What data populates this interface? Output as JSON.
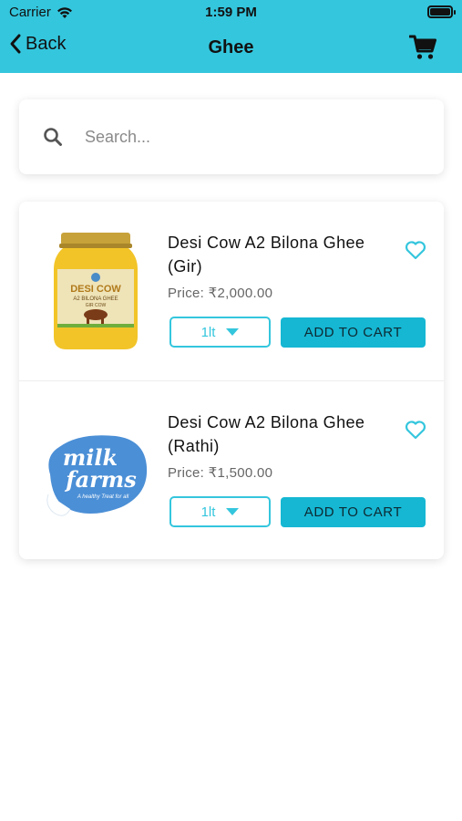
{
  "status_bar": {
    "carrier": "Carrier",
    "time": "1:59 PM"
  },
  "nav": {
    "back_label": "Back",
    "title": "Ghee"
  },
  "search": {
    "placeholder": "Search..."
  },
  "products": [
    {
      "name": "Desi Cow A2 Bilona Ghee (Gir)",
      "price": "Price: ₹2,000.00",
      "quantity": "1lt",
      "add_label": "ADD TO CART",
      "image_text": {
        "line1": "DESI COW",
        "line2": "A2 BILONA GHEE",
        "line3": "GIR COW"
      }
    },
    {
      "name": "Desi Cow A2 Bilona Ghee (Rathi)",
      "price": "Price: ₹1,500.00",
      "quantity": "1lt",
      "add_label": "ADD TO CART",
      "image_text": {
        "line1": "milk",
        "line2": "farms",
        "line3": "A healthy Treat for all"
      }
    }
  ],
  "colors": {
    "accent": "#34c6dd",
    "button": "#15b7d3",
    "background": "#ffffff"
  }
}
